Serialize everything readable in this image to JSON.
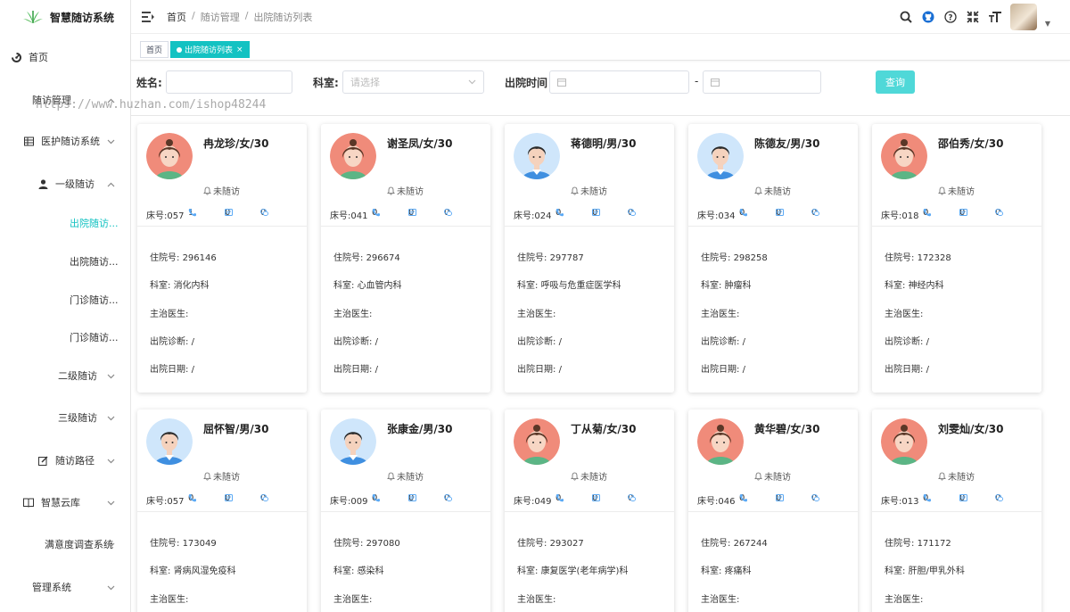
{
  "app": {
    "title": "智慧随访系统"
  },
  "sidebar": {
    "items": [
      {
        "label": "首页",
        "icon": "dashboard-icon"
      },
      {
        "label": "随访管理",
        "icon": "",
        "chevron": "up"
      },
      {
        "label": "医护随访系统",
        "icon": "grid-icon",
        "chevron": "down"
      },
      {
        "label": "一级随访",
        "icon": "user-icon",
        "chevron": "up"
      },
      {
        "label": "出院随访...",
        "icon": "",
        "active": true
      },
      {
        "label": "出院随访...",
        "icon": ""
      },
      {
        "label": "门诊随访...",
        "icon": ""
      },
      {
        "label": "门诊随访...",
        "icon": ""
      },
      {
        "label": "二级随访",
        "icon": "",
        "chevron": "down"
      },
      {
        "label": "三级随访",
        "icon": "",
        "chevron": "down"
      },
      {
        "label": "随访路径",
        "icon": "edit-icon",
        "chevron": "down"
      },
      {
        "label": "智慧云库",
        "icon": "book-icon",
        "chevron": "down"
      },
      {
        "label": "满意度调查系统",
        "icon": "",
        "chevron": "down"
      },
      {
        "label": "管理系统",
        "icon": "",
        "chevron": "down"
      }
    ]
  },
  "watermark": "https://www.huzhan.com/ishop48244",
  "breadcrumb": {
    "home": "首页",
    "section": "随访管理",
    "page": "出院随访列表",
    "sep": "/"
  },
  "tags": {
    "home": "首页",
    "current": "出院随访列表",
    "close": "×"
  },
  "search": {
    "name_label": "姓名:",
    "dept_label": "科室:",
    "dept_placeholder": "请选择",
    "date_label": "出院时间",
    "date_sep": "-",
    "query_label": "查询"
  },
  "card_labels": {
    "status": "未随访",
    "admission": "住院号:",
    "dept": "科室:",
    "doctor": "主治医生:",
    "diagnosis": "出院诊断:",
    "discharge_date": "出院日期:"
  },
  "patients": [
    {
      "name": "冉龙珍/女/30",
      "gender": "female",
      "bed": "床号:057",
      "phone": "1",
      "msg": "0",
      "wechat": "0",
      "admission_no": "296146",
      "dept": "消化内科",
      "doctor": "",
      "diagnosis": "/",
      "date": "/"
    },
    {
      "name": "谢圣凤/女/30",
      "gender": "female",
      "bed": "床号:041",
      "phone": "0",
      "msg": "0",
      "wechat": "0",
      "admission_no": "296674",
      "dept": "心血管内科",
      "doctor": "",
      "diagnosis": "/",
      "date": "/"
    },
    {
      "name": "蒋德明/男/30",
      "gender": "male",
      "bed": "床号:024",
      "phone": "0",
      "msg": "0",
      "wechat": "0",
      "admission_no": "297787",
      "dept": "呼吸与危重症医学科",
      "doctor": "",
      "diagnosis": "/",
      "date": "/"
    },
    {
      "name": "陈德友/男/30",
      "gender": "male",
      "bed": "床号:034",
      "phone": "0",
      "msg": "0",
      "wechat": "0",
      "admission_no": "298258",
      "dept": "肿瘤科",
      "doctor": "",
      "diagnosis": "/",
      "date": "/"
    },
    {
      "name": "邵伯秀/女/30",
      "gender": "female",
      "bed": "床号:018",
      "phone": "0",
      "msg": "0",
      "wechat": "0",
      "admission_no": "172328",
      "dept": "神经内科",
      "doctor": "",
      "diagnosis": "/",
      "date": "/"
    },
    {
      "name": "屈怀智/男/30",
      "gender": "male",
      "bed": "床号:057",
      "phone": "0",
      "msg": "0",
      "wechat": "0",
      "admission_no": "173049",
      "dept": "肾病风湿免疫科",
      "doctor": "",
      "diagnosis": "",
      "date": ""
    },
    {
      "name": "张康金/男/30",
      "gender": "male",
      "bed": "床号:009",
      "phone": "0",
      "msg": "0",
      "wechat": "0",
      "admission_no": "297080",
      "dept": "感染科",
      "doctor": "",
      "diagnosis": "",
      "date": ""
    },
    {
      "name": "丁从菊/女/30",
      "gender": "female",
      "bed": "床号:049",
      "phone": "0",
      "msg": "0",
      "wechat": "0",
      "admission_no": "293027",
      "dept": "康复医学(老年病学)科",
      "doctor": "",
      "diagnosis": "",
      "date": ""
    },
    {
      "name": "黄华碧/女/30",
      "gender": "female",
      "bed": "床号:046",
      "phone": "0",
      "msg": "0",
      "wechat": "0",
      "admission_no": "267244",
      "dept": "疼痛科",
      "doctor": "",
      "diagnosis": "",
      "date": ""
    },
    {
      "name": "刘雯灿/女/30",
      "gender": "female",
      "bed": "床号:013",
      "phone": "0",
      "msg": "0",
      "wechat": "0",
      "admission_no": "171172",
      "dept": "肝胆/甲乳外科",
      "doctor": "",
      "diagnosis": "",
      "date": ""
    }
  ],
  "colors": {
    "accent": "#13c2c2",
    "query_button": "#4fd8d8",
    "icon_blue": "#5aa9f5"
  }
}
